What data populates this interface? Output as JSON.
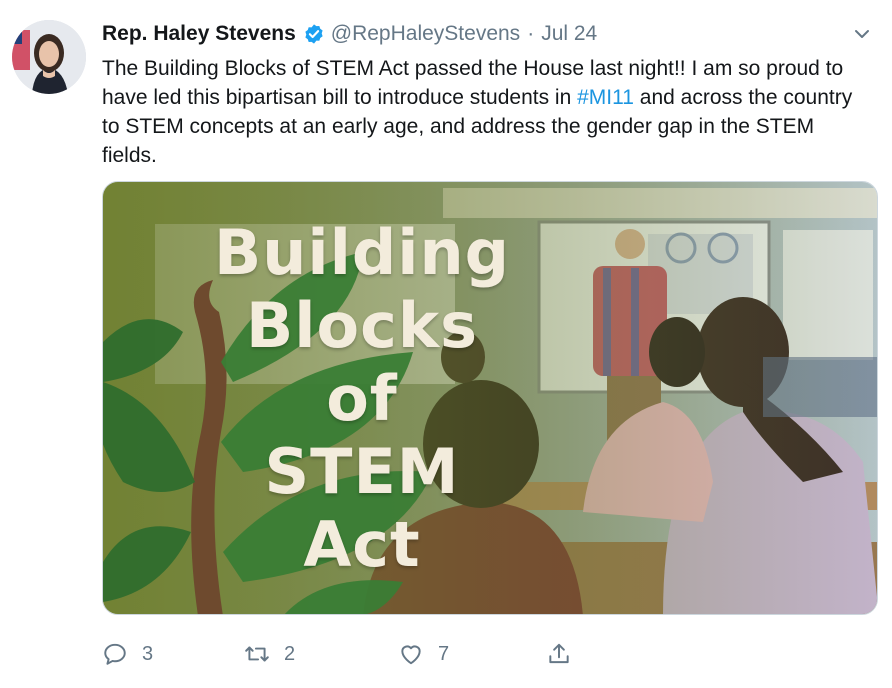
{
  "tweet": {
    "author_name": "Rep. Haley Stevens",
    "handle": "@RepHaleyStevens",
    "separator": "·",
    "date": "Jul 24",
    "text_before_hashtag": "The Building Blocks of STEM Act passed the House last night!! I am so proud to have led this bipartisan bill to introduce students in ",
    "hashtag": "#MI11",
    "text_after_hashtag": " and across the country to STEM concepts at an early age, and address the gender gap in the STEM fields."
  },
  "media": {
    "overlay_lines": [
      "Building",
      "Blocks",
      "of",
      "STEM",
      "Act"
    ]
  },
  "actions": {
    "reply_count": "3",
    "retweet_count": "2",
    "like_count": "7"
  },
  "colors": {
    "link": "#1b95e0",
    "muted": "#657786",
    "verified": "#1da1f2",
    "overlay_text": "#f3ecdc"
  },
  "icons": [
    "verified-badge-icon",
    "chevron-down-icon",
    "reply-icon",
    "retweet-icon",
    "like-icon",
    "share-icon"
  ]
}
